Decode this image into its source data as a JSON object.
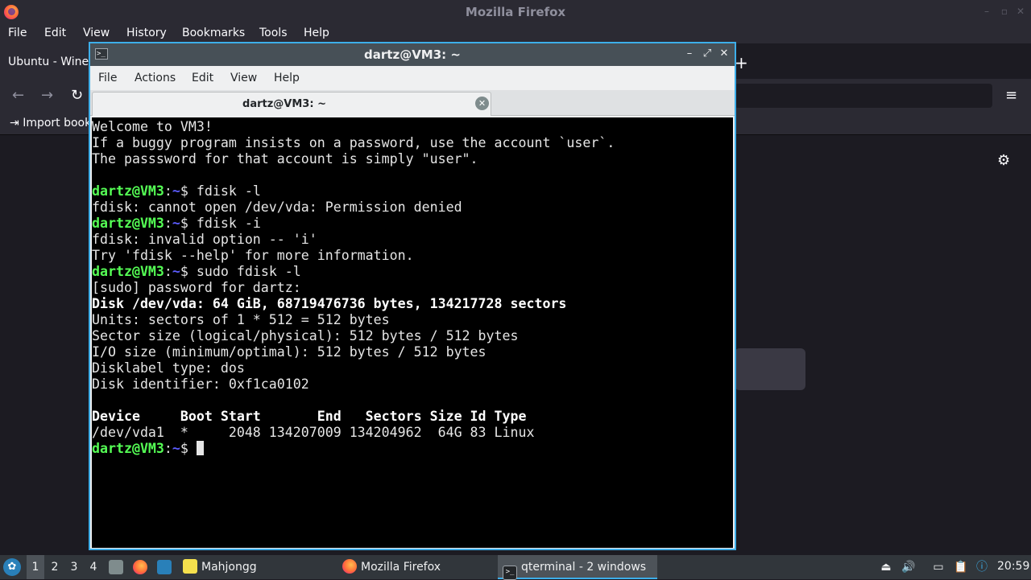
{
  "firefox": {
    "window_title": "Mozilla Firefox",
    "menu": [
      "File",
      "Edit",
      "View",
      "History",
      "Bookmarks",
      "Tools",
      "Help"
    ],
    "tab_label": "Ubuntu - WineH",
    "import_bookmarks": "Import book",
    "icons": {
      "logo": "firefox-logo-icon",
      "back": "back-arrow-icon",
      "forward": "forward-arrow-icon",
      "reload": "reload-icon",
      "menu": "hamburger-menu-icon",
      "settings": "gear-icon",
      "new_tab": "plus-icon"
    }
  },
  "terminal": {
    "window_title": "dartz@VM3: ~",
    "menu": [
      "File",
      "Actions",
      "Edit",
      "View",
      "Help"
    ],
    "tab_label": "dartz@VM3: ~",
    "prompt_user": "dartz@VM3",
    "prompt_path": "~",
    "lines": [
      {
        "type": "text",
        "text": "Welcome to VM3!"
      },
      {
        "type": "text",
        "text": "If a buggy program insists on a password, use the account `user`."
      },
      {
        "type": "text",
        "text": "The passsword for that account is simply \"user\"."
      },
      {
        "type": "text",
        "text": ""
      },
      {
        "type": "prompt",
        "cmd": "$ fdisk -l"
      },
      {
        "type": "text",
        "text": "fdisk: cannot open /dev/vda: Permission denied"
      },
      {
        "type": "prompt",
        "cmd": "$ fdisk -i"
      },
      {
        "type": "text",
        "text": "fdisk: invalid option -- 'i'"
      },
      {
        "type": "text",
        "text": "Try 'fdisk --help' for more information."
      },
      {
        "type": "prompt",
        "cmd": "$ sudo fdisk -l"
      },
      {
        "type": "text",
        "text": "[sudo] password for dartz:"
      },
      {
        "type": "bold",
        "text": "Disk /dev/vda: 64 GiB, 68719476736 bytes, 134217728 sectors"
      },
      {
        "type": "text",
        "text": "Units: sectors of 1 * 512 = 512 bytes"
      },
      {
        "type": "text",
        "text": "Sector size (logical/physical): 512 bytes / 512 bytes"
      },
      {
        "type": "text",
        "text": "I/O size (minimum/optimal): 512 bytes / 512 bytes"
      },
      {
        "type": "text",
        "text": "Disklabel type: dos"
      },
      {
        "type": "text",
        "text": "Disk identifier: 0xf1ca0102"
      },
      {
        "type": "text",
        "text": ""
      },
      {
        "type": "bold",
        "text": "Device     Boot Start       End   Sectors Size Id Type"
      },
      {
        "type": "text",
        "text": "/dev/vda1  *     2048 134207009 134204962  64G 83 Linux"
      },
      {
        "type": "prompt",
        "cmd": "$ ",
        "cursor": true
      }
    ]
  },
  "taskbar": {
    "workspaces": [
      "1",
      "2",
      "3",
      "4"
    ],
    "active_workspace": "1",
    "tasks": [
      {
        "label": "Mahjongg",
        "icon": "mahjongg-icon"
      },
      {
        "label": "Mozilla Firefox",
        "icon": "firefox-icon"
      },
      {
        "label": "qterminal - 2 windows",
        "icon": "terminal-icon"
      }
    ],
    "clock": "20:59",
    "tray_icons": [
      "eject-icon",
      "volume-icon",
      "network-icon",
      "clipboard-icon",
      "updates-icon"
    ]
  }
}
